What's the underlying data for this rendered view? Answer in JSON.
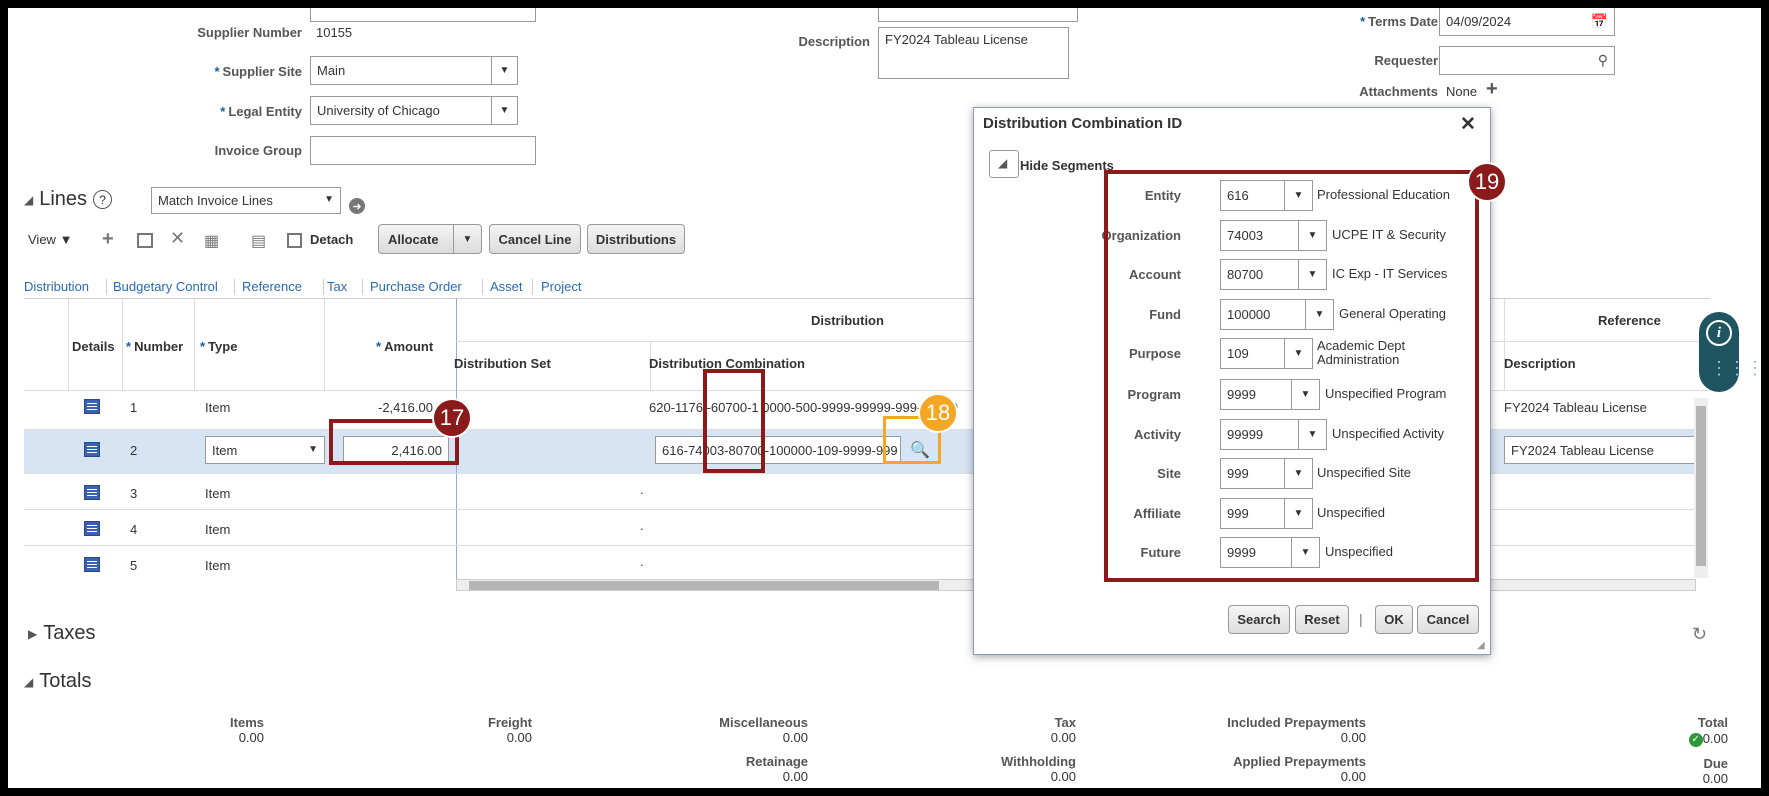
{
  "header": {
    "supplier_number_label": "Supplier Number",
    "supplier_number": "10155",
    "supplier_site_label": "Supplier Site",
    "supplier_site": "Main",
    "legal_entity_label": "Legal Entity",
    "legal_entity": "University of Chicago",
    "invoice_group_label": "Invoice Group",
    "invoice_group": "",
    "description_label": "Description",
    "description": "FY2024 Tableau License",
    "terms_date_label": "Terms Date",
    "terms_date": "04/09/2024",
    "requester_label": "Requester",
    "requester": "",
    "attachments_label": "Attachments",
    "attachments_value": "None"
  },
  "lines": {
    "title": "Lines",
    "match_select": "Match Invoice Lines",
    "view_label": "View",
    "detach_label": "Detach",
    "allocate_label": "Allocate",
    "cancel_line_label": "Cancel Line",
    "distributions_label": "Distributions",
    "tabs": [
      "Distribution",
      "Budgetary Control",
      "Reference",
      "Tax",
      "Purchase Order",
      "Asset",
      "Project"
    ],
    "group_distribution": "Distribution",
    "group_reference": "Reference",
    "columns": {
      "details": "Details",
      "number": "Number",
      "type": "Type",
      "amount": "Amount",
      "distribution_set": "Distribution Set",
      "distribution_combination": "Distribution Combination",
      "description": "Description"
    },
    "rows": [
      {
        "number": "1",
        "type": "Item",
        "amount": "-2,416.00",
        "combination": "620-1176 -60700-1 0000-500-9999-99999-999-9 0-99",
        "description": "FY2024 Tableau License"
      },
      {
        "number": "2",
        "type": "Item",
        "amount": "2,416.00",
        "combination": "616-74003-80700-100000-109-9999-999",
        "description": "FY2024 Tableau License"
      },
      {
        "number": "3",
        "type": "Item",
        "amount": "",
        "combination": ".",
        "description": ""
      },
      {
        "number": "4",
        "type": "Item",
        "amount": "",
        "combination": ".",
        "description": ""
      },
      {
        "number": "5",
        "type": "Item",
        "amount": "",
        "combination": ".",
        "description": ""
      }
    ]
  },
  "taxes": {
    "title": "Taxes"
  },
  "totals": {
    "title": "Totals",
    "items_label": "Items",
    "items": "0.00",
    "freight_label": "Freight",
    "freight": "0.00",
    "misc_label": "Miscellaneous",
    "misc": "0.00",
    "tax_label": "Tax",
    "tax": "0.00",
    "incl_prepay_label": "Included Prepayments",
    "incl_prepay": "0.00",
    "total_label": "Total",
    "total": "0.00",
    "retainage_label": "Retainage",
    "retainage": "0.00",
    "withholding_label": "Withholding",
    "withholding": "0.00",
    "appl_prepay_label": "Applied Prepayments",
    "appl_prepay": "0.00",
    "due_label": "Due",
    "due": "0.00"
  },
  "dialog": {
    "title": "Distribution Combination ID",
    "hide_segments": "Hide Segments",
    "segments": [
      {
        "label": "Entity",
        "value": "616",
        "desc": "Professional Education"
      },
      {
        "label": "Organization",
        "value": "74003",
        "desc": "UCPE IT & Security"
      },
      {
        "label": "Account",
        "value": "80700",
        "desc": "IC Exp - IT Services"
      },
      {
        "label": "Fund",
        "value": "100000",
        "desc": "General Operating"
      },
      {
        "label": "Purpose",
        "value": "109",
        "desc": "Academic Dept Administration"
      },
      {
        "label": "Program",
        "value": "9999",
        "desc": "Unspecified Program"
      },
      {
        "label": "Activity",
        "value": "99999",
        "desc": "Unspecified Activity"
      },
      {
        "label": "Site",
        "value": "999",
        "desc": "Unspecified Site"
      },
      {
        "label": "Affiliate",
        "value": "999",
        "desc": "Unspecified"
      },
      {
        "label": "Future",
        "value": "9999",
        "desc": "Unspecified"
      }
    ],
    "search_label": "Search",
    "reset_label": "Reset",
    "separator": "|",
    "ok_label": "OK",
    "cancel_label": "Cancel"
  },
  "annotations": {
    "badge_17": "17",
    "badge_18": "18",
    "badge_19": "19",
    "dark_red": "#8b1a1a",
    "orange": "#f5a623"
  }
}
